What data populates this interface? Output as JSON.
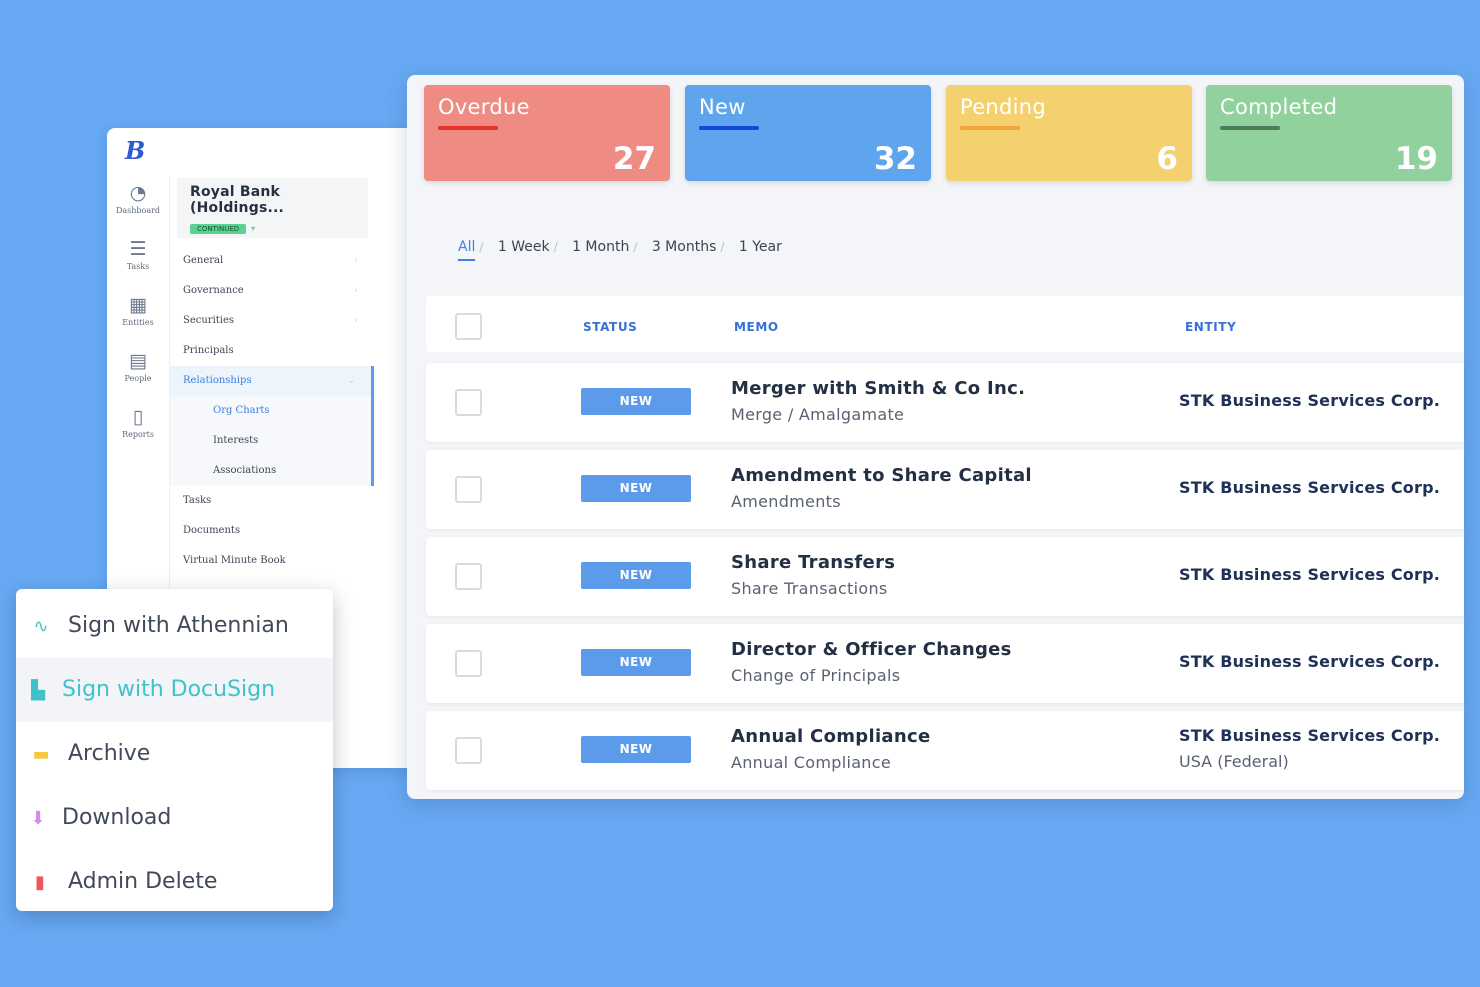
{
  "colors": {
    "background": "#67a9f3",
    "overdue": "#ee8c84",
    "overdue_bar": "#e8322c",
    "new": "#5ea5ee",
    "new_bar": "#1246d8",
    "pending": "#f5d06e",
    "pending_bar": "#f0a53a",
    "completed": "#91d19e",
    "completed_bar": "#4b7b58",
    "status_badge": "#5b9be9",
    "docusign_highlight": "#3fc2c9"
  },
  "sidebar": {
    "logo": "B",
    "rail": [
      {
        "icon": "dashboard-icon",
        "label": "Dashboard"
      },
      {
        "icon": "tasks-icon",
        "label": "Tasks"
      },
      {
        "icon": "entities-icon",
        "label": "Entities"
      },
      {
        "icon": "people-icon",
        "label": "People"
      },
      {
        "icon": "reports-icon",
        "label": "Reports"
      }
    ],
    "entity": {
      "name": "Royal Bank (Holdings...",
      "status": "CONTINUED"
    },
    "menu": [
      {
        "label": "General",
        "caret": "‹"
      },
      {
        "label": "Governance",
        "caret": "‹"
      },
      {
        "label": "Securities",
        "caret": "‹"
      },
      {
        "label": "Principals",
        "caret": ""
      },
      {
        "label": "Relationships",
        "caret": "⌄"
      },
      {
        "label": "Org Charts",
        "caret": ""
      },
      {
        "label": "Interests",
        "caret": ""
      },
      {
        "label": "Associations",
        "caret": ""
      },
      {
        "label": "Tasks",
        "caret": ""
      },
      {
        "label": "Documents",
        "caret": ""
      },
      {
        "label": "Virtual Minute Book",
        "caret": ""
      }
    ]
  },
  "stats": [
    {
      "label": "Overdue",
      "value": "27"
    },
    {
      "label": "New",
      "value": "32"
    },
    {
      "label": "Pending",
      "value": "6"
    },
    {
      "label": "Completed",
      "value": "19"
    }
  ],
  "filters": [
    "All",
    "1 Week",
    "1 Month",
    "3 Months",
    "1 Year"
  ],
  "table": {
    "headers": {
      "status": "STATUS",
      "memo": "MEMO",
      "entity": "ENTITY"
    },
    "rows": [
      {
        "status": "NEW",
        "title": "Merger with Smith & Co Inc.",
        "subtitle": "Merge / Amalgamate",
        "entity": "STK Business Services Corp.",
        "entity_sub": ""
      },
      {
        "status": "NEW",
        "title": "Amendment to Share Capital",
        "subtitle": "Amendments",
        "entity": "STK Business Services Corp.",
        "entity_sub": ""
      },
      {
        "status": "NEW",
        "title": "Share Transfers",
        "subtitle": "Share Transactions",
        "entity": "STK Business Services Corp.",
        "entity_sub": ""
      },
      {
        "status": "NEW",
        "title": "Director & Officer Changes",
        "subtitle": "Change of Principals",
        "entity": "STK Business Services Corp.",
        "entity_sub": ""
      },
      {
        "status": "NEW",
        "title": "Annual Compliance",
        "subtitle": "Annual Compliance",
        "entity": "STK Business Services Corp.",
        "entity_sub": "USA (Federal)"
      }
    ]
  },
  "popup": [
    {
      "icon": "signature-icon",
      "label": "Sign with Athennian"
    },
    {
      "icon": "docusign-icon",
      "label": "Sign with DocuSign"
    },
    {
      "icon": "archive-icon",
      "label": "Archive"
    },
    {
      "icon": "download-icon",
      "label": "Download"
    },
    {
      "icon": "trash-icon",
      "label": "Admin Delete"
    }
  ]
}
